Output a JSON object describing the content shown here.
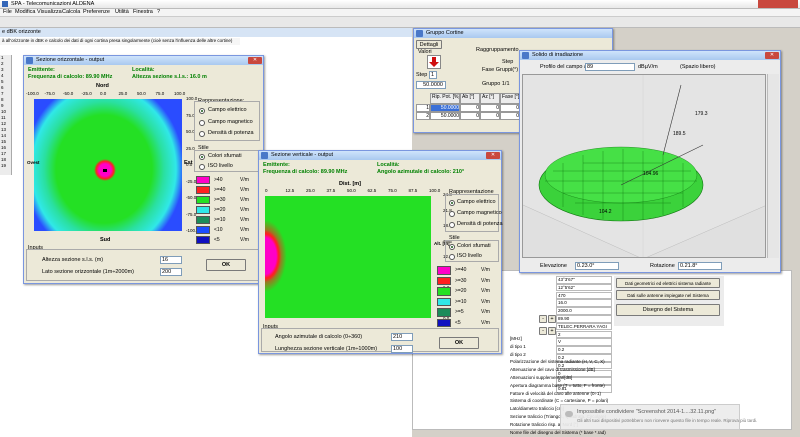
{
  "app": {
    "title": "SPA - Telecomunicazioni ALDENA",
    "menu": [
      "File",
      "Modifica",
      "Visualizza",
      "Calcola",
      "Preferenze",
      "Utilità",
      "Finestra",
      "?"
    ]
  },
  "background": {
    "main_label": "e dBK orizzonte",
    "bar_text": "à all'orizzonte in dBK e calcolo dei dati di ogni cortina presa singolarmente (cioè senza l'influenza delle altre cortine)",
    "rows": [
      "1",
      "2",
      "3",
      "4",
      "5",
      "6",
      "7",
      "8",
      "9",
      "10",
      "11",
      "12",
      "13",
      "14",
      "15",
      "16",
      "17",
      "18",
      "19"
    ]
  },
  "horizontal": {
    "title": "Sezione orizzontale - output",
    "emitter_label": "Emittente:",
    "freq": "Frequenza di calcolo: 89.90 MHz",
    "loc_label": "Località:",
    "alt": "Altezza sezione s.l.s.: 16.0 m",
    "north": "Nord",
    "south": "Sud",
    "west": "Ovest",
    "east": "Est",
    "xticks": [
      "-100.0",
      "-75.0",
      "-50.0",
      "-25.0",
      "0.0",
      "25.0",
      "50.0",
      "75.0",
      "100.0"
    ],
    "yticks": [
      "100.0",
      "75.0",
      "50.0",
      "25.0",
      "0.0",
      "-25.0",
      "-50.0",
      "-75.0",
      "-100.0"
    ],
    "rappr_label": "Rappresentazione:",
    "rappr": [
      "Campo elettrico",
      "Campo magnetico",
      "Densità di potenza"
    ],
    "stile_label": "Stile",
    "stile": [
      "Colori sfumati",
      "ISO livello"
    ],
    "legend": [
      {
        "label": ">40",
        "unit": "V/m",
        "color": "#ff00c8"
      },
      {
        "label": ">=40",
        "unit": "V/m",
        "color": "#ff2020"
      },
      {
        "label": ">=30",
        "unit": "V/m",
        "color": "#24e024"
      },
      {
        "label": ">=20",
        "unit": "V/m",
        "color": "#30e8e8"
      },
      {
        "label": ">=10",
        "unit": "V/m",
        "color": "#1c8c5a"
      },
      {
        "label": "<10",
        "unit": "V/m",
        "color": "#1c4cff"
      },
      {
        "label": "<5",
        "unit": "V/m",
        "color": "#1010c0"
      }
    ],
    "inputs_label": "Inputs",
    "input1_label": "Altezza sezione s.l.s. (m)",
    "input1_value": "16",
    "input2_label": "Lato sezione orizzontale (1m÷2000m)",
    "input2_value": "200",
    "ok": "OK"
  },
  "vertical": {
    "title": "Sezione verticale - output",
    "emitter_label": "Emittente:",
    "freq": "Frequenza di calcolo: 89.90 MHz",
    "loc_label": "Località:",
    "angle": "Angolo azimutale di calcolo: 210°",
    "dist_label": "Dist. [m]",
    "alt_label": "Alt. [m]",
    "xticks": [
      "0",
      "12.5",
      "25.0",
      "37.5",
      "50.0",
      "62.5",
      "75.0",
      "87.5",
      "100.0"
    ],
    "yticks": [
      "24.8",
      "21.8",
      "18.6",
      "15.5",
      "12.4",
      "9.3",
      "6.2",
      "3.1",
      "0.0"
    ],
    "rappr_label": "Rappresentazione",
    "rappr": [
      "Campo elettrico",
      "Campo magnetico",
      "Densità di potenza"
    ],
    "stile_label": "Stile",
    "stile": [
      "Colori sfumati",
      "ISO livello"
    ],
    "legend": [
      {
        "label": ">=40",
        "unit": "V/m",
        "color": "#ff00c8"
      },
      {
        "label": ">=30",
        "unit": "V/m",
        "color": "#ff2020"
      },
      {
        "label": ">=20",
        "unit": "V/m",
        "color": "#24e024"
      },
      {
        "label": ">=10",
        "unit": "V/m",
        "color": "#30e8e8"
      },
      {
        "label": ">=5",
        "unit": "V/m",
        "color": "#1c8c5a"
      },
      {
        "label": "<5",
        "unit": "V/m",
        "color": "#1010c0"
      }
    ],
    "inputs_label": "Inputs",
    "input1_label": "Angolo azimutale di calcolo (0÷360)",
    "input1_value": "210",
    "input2_label": "Lunghezza sezione verticale (1m÷1000m)",
    "input2_value": "100",
    "ok": "OK"
  },
  "diagram": {
    "title": "Gruppo Cortine",
    "tab": "Dettagli",
    "valori": "Valori",
    "step": "Step",
    "step_value": "1",
    "value_field": "50.0000",
    "ragg": "Raggruppamento",
    "ragg_step": "Step",
    "fase_label": "Fase Gruppi(°)",
    "gruppo": "Gruppo 1/1",
    "headers": [
      "Rip. Pot. [%]",
      "Ab [°]",
      "Az [°]",
      "Fase [°]"
    ],
    "rows": [
      [
        "1",
        "50.0000",
        "0",
        "0",
        "0"
      ],
      [
        "2",
        "50.0000",
        "0",
        "0",
        "0"
      ]
    ]
  },
  "solid": {
    "title": "Solido di irradiazione",
    "profilo_label": "Profilo del campo a",
    "profilo_value": "89",
    "unit": "dBµV/m",
    "spazio": "(Spazio libero)",
    "elev_label": "Elevazione",
    "elev_value": "0.23.0°",
    "rot_label": "Rotazione",
    "rot_value": "0.21.8°",
    "labels_3d": [
      "189.5",
      "179.3",
      "104.2",
      "104.96"
    ]
  },
  "system": {
    "buttons": [
      "Dati geometrici ed elettrici sistema radiante",
      "Dati sulle antenne impiegate nel Sistema",
      "Disegno del Sistema"
    ],
    "values": [
      "43°3'67\"",
      "12°5'62\"",
      "470",
      "16.0",
      "2000.0",
      "89.90",
      "TELEC.PERRARA YAGI",
      "2",
      "V",
      "0.2",
      "0.2",
      "0.2",
      "0",
      "0",
      "0.81"
    ],
    "labels": [
      "[MHz]",
      "di tipo 1",
      "di tipo 2",
      "Polarizzazione del sistema radiante (H, V, C, X)",
      "Attenuazione del cavo di trasmissione [dB]",
      "Attenuazioni supplementari[dB]",
      "Apertura diagramma base (T = tutto, F = fronte)",
      "Fattore di velocità del cavo alle antenne (0÷1)",
      "Sistema di coordinate (C = cartesiane, P = polari)",
      "Lato/diametro traliccio [cm]",
      "Sezione traliccio (Triangol., Quadrata, Circolare)",
      "Rotazione traliccio risp. al Nord [°]",
      "Nome file del disegno del Sistema (* base *.rad)"
    ]
  },
  "notification": {
    "title": "Impossibile condividere \"Screenshot 2014-1....32.11.png\"",
    "body": "Gli altri tuoi dispositivi potrebbero non ricevere questo file in tempo reale. Riprova più tardi."
  }
}
